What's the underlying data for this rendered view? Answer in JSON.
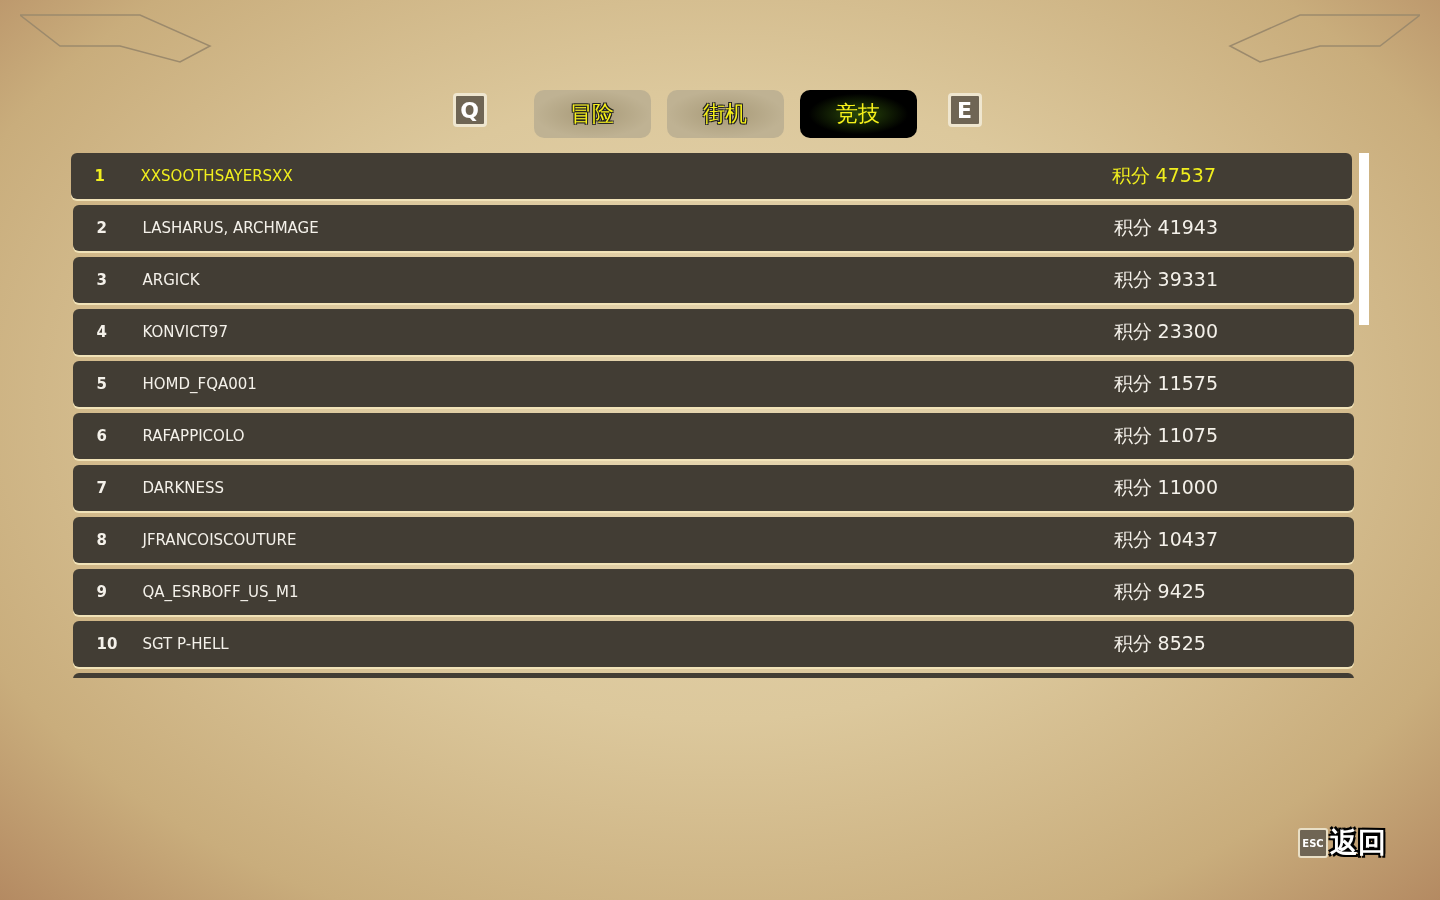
{
  "tabs": {
    "prev_key": "Q",
    "next_key": "E",
    "items": [
      {
        "label": "冒险",
        "selected": false
      },
      {
        "label": "街机",
        "selected": false
      },
      {
        "label": "竞技",
        "selected": true
      }
    ]
  },
  "leaderboard": {
    "rows": [
      {
        "rank": "1",
        "name": "XXSOOTHSAYERSXX",
        "score": "积分 47537",
        "highlighted": true
      },
      {
        "rank": "2",
        "name": "LASHARUS, ARCHMAGE",
        "score": "积分 41943",
        "highlighted": false
      },
      {
        "rank": "3",
        "name": "ARGICK",
        "score": "积分 39331",
        "highlighted": false
      },
      {
        "rank": "4",
        "name": "KONVICT97",
        "score": "积分 23300",
        "highlighted": false
      },
      {
        "rank": "5",
        "name": "HOMD_FQA001",
        "score": "积分 11575",
        "highlighted": false
      },
      {
        "rank": "6",
        "name": "RAFAPPICOLO",
        "score": "积分 11075",
        "highlighted": false
      },
      {
        "rank": "7",
        "name": "DARKNESS",
        "score": "积分 11000",
        "highlighted": false
      },
      {
        "rank": "8",
        "name": "JFRANCOISCOUTURE",
        "score": "积分 10437",
        "highlighted": false
      },
      {
        "rank": "9",
        "name": "QA_ESRBOFF_US_M1",
        "score": "积分 9425",
        "highlighted": false
      },
      {
        "rank": "10",
        "name": "SGT P-HELL",
        "score": "积分 8525",
        "highlighted": false
      }
    ]
  },
  "back": {
    "key": "ESC",
    "label": "返回"
  }
}
